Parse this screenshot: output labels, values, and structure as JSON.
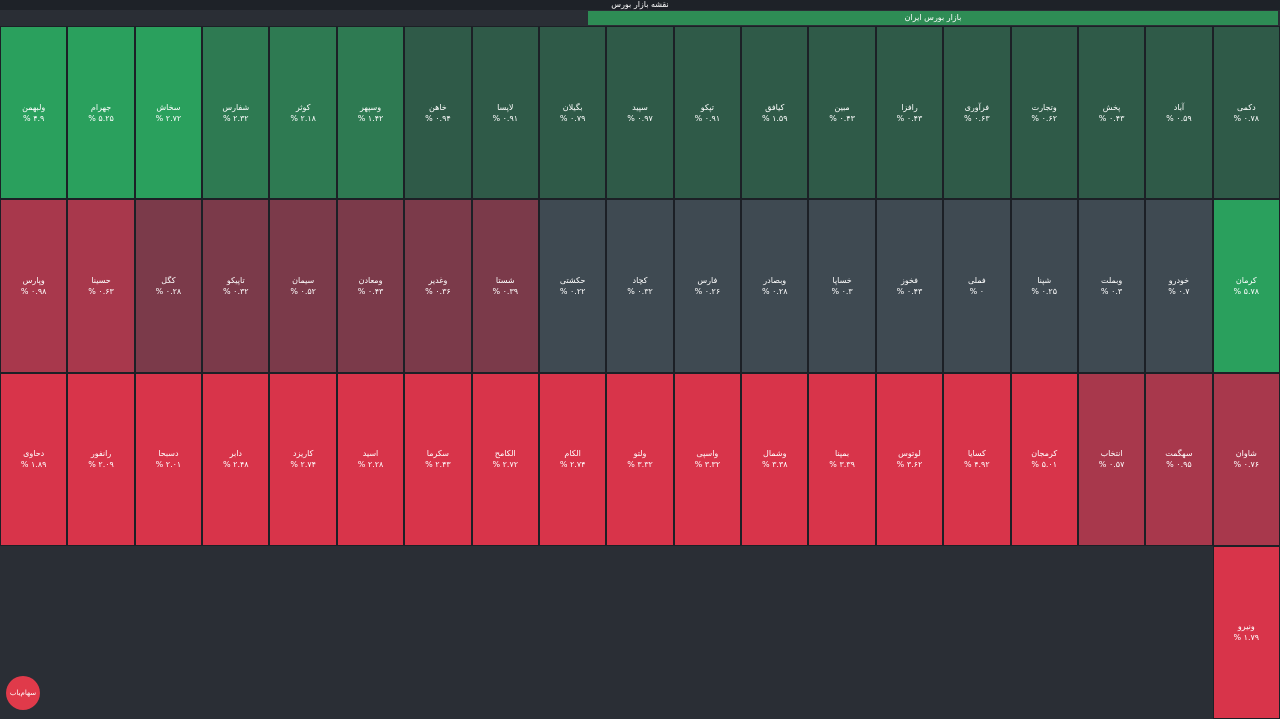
{
  "header": {
    "title": "نقشه بازار بورس",
    "market": "بازار بورس ایران"
  },
  "logo": {
    "text": "سهام‌یاب"
  },
  "colors": {
    "red_strong": "#d8344a",
    "red_mid": "#a8384c",
    "red_soft": "#7b3a4a",
    "neutral": "#3f4a52",
    "green_soft": "#2f5a48",
    "green_mid": "#2e7a52",
    "green_strong": "#2aa05d"
  },
  "tiles": [
    {
      "sym": "دکمی",
      "chg": "۰.۷۸ %",
      "tone": "green_soft"
    },
    {
      "sym": "آباد",
      "chg": "۰.۵۹ %",
      "tone": "green_soft"
    },
    {
      "sym": "پخش",
      "chg": "۰.۴۳ %",
      "tone": "green_soft"
    },
    {
      "sym": "وتجارت",
      "chg": "۰.۶۲ %",
      "tone": "green_soft"
    },
    {
      "sym": "فرآوری",
      "chg": "۰.۶۳ %",
      "tone": "green_soft"
    },
    {
      "sym": "رافزا",
      "chg": "۰.۴۳ %",
      "tone": "green_soft"
    },
    {
      "sym": "مبین",
      "chg": "۰.۴۳ %",
      "tone": "green_soft"
    },
    {
      "sym": "کیافق",
      "chg": "۱.۵۹ %",
      "tone": "green_soft"
    },
    {
      "sym": "تپکو",
      "chg": "۰.۹۱ %",
      "tone": "green_soft"
    },
    {
      "sym": "سپید",
      "chg": "۰.۹۷ %",
      "tone": "green_soft"
    },
    {
      "sym": "بگیلان",
      "chg": "۰.۷۹ %",
      "tone": "green_soft"
    },
    {
      "sym": "لاپسا",
      "chg": "۰.۹۱ %",
      "tone": "green_soft"
    },
    {
      "sym": "خاهن",
      "chg": "۰.۹۴ %",
      "tone": "green_soft"
    },
    {
      "sym": "وسپهر",
      "chg": "۱.۴۲ %",
      "tone": "green_mid"
    },
    {
      "sym": "کوثر",
      "chg": "۲.۱۸ %",
      "tone": "green_mid"
    },
    {
      "sym": "شفارس",
      "chg": "۲.۳۲ %",
      "tone": "green_mid"
    },
    {
      "sym": "سخاش",
      "chg": "۲.۷۲ %",
      "tone": "green_strong"
    },
    {
      "sym": "جهرام",
      "chg": "۵.۲۵ %",
      "tone": "green_strong"
    },
    {
      "sym": "ولبهمن",
      "chg": "۴.۹ %",
      "tone": "green_strong"
    },
    {
      "sym": "کرمان",
      "chg": "۵.۷۸ %",
      "tone": "green_strong"
    },
    {
      "sym": "خودرو",
      "chg": "۰.۷ %",
      "tone": "neutral"
    },
    {
      "sym": "وبملت",
      "chg": "۰.۳ %",
      "tone": "neutral"
    },
    {
      "sym": "شپنا",
      "chg": "۰.۲۵ %",
      "tone": "neutral"
    },
    {
      "sym": "فملی",
      "chg": "۰ %",
      "tone": "neutral"
    },
    {
      "sym": "فخوز",
      "chg": "۰.۴۳ %",
      "tone": "neutral"
    },
    {
      "sym": "خساپا",
      "chg": "۰.۳ %",
      "tone": "neutral"
    },
    {
      "sym": "وبصادر",
      "chg": "۰.۲۸ %",
      "tone": "neutral"
    },
    {
      "sym": "فارس",
      "chg": "۰.۲۶ %",
      "tone": "neutral"
    },
    {
      "sym": "کچاد",
      "chg": "۰.۳۲ %",
      "tone": "neutral"
    },
    {
      "sym": "حکشتی",
      "chg": "۰.۲۲ %",
      "tone": "neutral"
    },
    {
      "sym": "شستا",
      "chg": "۰.۳۹ %",
      "tone": "red_soft"
    },
    {
      "sym": "وغدیر",
      "chg": "۰.۳۶ %",
      "tone": "red_soft"
    },
    {
      "sym": "ومعادن",
      "chg": "۰.۴۳ %",
      "tone": "red_soft"
    },
    {
      "sym": "سیمان",
      "chg": "۰.۵۲ %",
      "tone": "red_soft"
    },
    {
      "sym": "تاپیکو",
      "chg": "۰.۳۲ %",
      "tone": "red_soft"
    },
    {
      "sym": "کگل",
      "chg": "۰.۲۸ %",
      "tone": "red_soft"
    },
    {
      "sym": "حسینا",
      "chg": "۰.۶۳ %",
      "tone": "red_mid"
    },
    {
      "sym": "وپارس",
      "chg": "۰.۹۸ %",
      "tone": "red_mid"
    },
    {
      "sym": "شاوان",
      "chg": "۰.۷۶ %",
      "tone": "red_mid"
    },
    {
      "sym": "سهگمت",
      "chg": "۰.۹۵ %",
      "tone": "red_mid"
    },
    {
      "sym": "انتخاب",
      "chg": "۰.۵۷ %",
      "tone": "red_mid"
    },
    {
      "sym": "کرمجان",
      "chg": "۵.۰۱ %",
      "tone": "red_strong"
    },
    {
      "sym": "کسایا",
      "chg": "۴.۹۲ %",
      "tone": "red_strong"
    },
    {
      "sym": "لوتوس",
      "chg": "۳.۶۲ %",
      "tone": "red_strong"
    },
    {
      "sym": "بمپنا",
      "chg": "۳.۳۹ %",
      "tone": "red_strong"
    },
    {
      "sym": "وشمال",
      "chg": "۳.۳۸ %",
      "tone": "red_strong"
    },
    {
      "sym": "واسپی",
      "chg": "۳.۳۲ %",
      "tone": "red_strong"
    },
    {
      "sym": "ولتو",
      "chg": "۳.۳۲ %",
      "tone": "red_strong"
    },
    {
      "sym": "الکام",
      "chg": "۲.۷۴ %",
      "tone": "red_strong"
    },
    {
      "sym": "الکامح",
      "chg": "۲.۷۲ %",
      "tone": "red_strong"
    },
    {
      "sym": "سکرما",
      "chg": "۲.۴۳ %",
      "tone": "red_strong"
    },
    {
      "sym": "اسید",
      "chg": "۲.۲۸ %",
      "tone": "red_strong"
    },
    {
      "sym": "کاریزد",
      "chg": "۲.۷۴ %",
      "tone": "red_strong"
    },
    {
      "sym": "دابر",
      "chg": "۲.۴۸ %",
      "tone": "red_strong"
    },
    {
      "sym": "دسبحا",
      "chg": "۲.۰۱ %",
      "tone": "red_strong"
    },
    {
      "sym": "رانفور",
      "chg": "۲.۰۹ %",
      "tone": "red_strong"
    },
    {
      "sym": "دحاوی",
      "chg": "۱.۸۹ %",
      "tone": "red_strong"
    },
    {
      "sym": "ونیرو",
      "chg": "۱.۷۹ %",
      "tone": "red_strong"
    }
  ]
}
